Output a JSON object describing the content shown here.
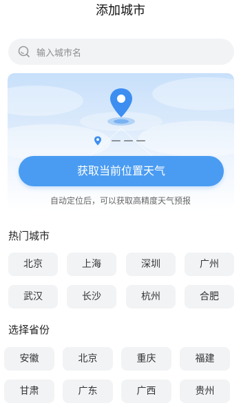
{
  "header": {
    "title": "添加城市"
  },
  "search": {
    "placeholder": "输入城市名"
  },
  "locate": {
    "current_location": "———",
    "button_label": "获取当前位置天气",
    "hint": "自动定位后，可以获取高精度天气预报"
  },
  "hot_cities": {
    "title": "热门城市",
    "items": [
      "北京",
      "上海",
      "深圳",
      "广州",
      "武汉",
      "长沙",
      "杭州",
      "合肥"
    ]
  },
  "provinces": {
    "title": "选择省份",
    "items": [
      "安徽",
      "北京",
      "重庆",
      "福建",
      "甘肃",
      "广东",
      "广西",
      "贵州"
    ]
  },
  "colors": {
    "accent": "#4a9cf2",
    "chip_bg": "#f2f3f5",
    "card_top": "#c8e0fb"
  }
}
